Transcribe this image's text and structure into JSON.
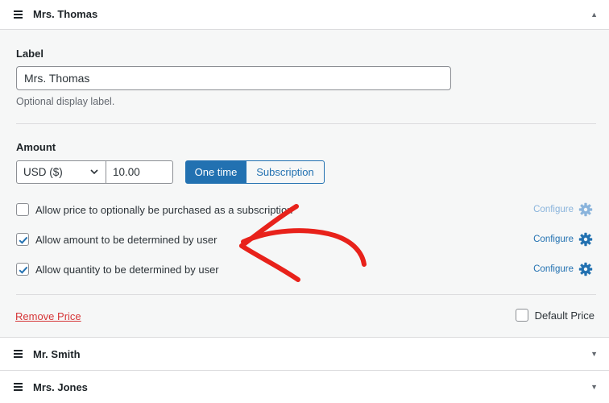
{
  "price_panel": {
    "title": "Mrs. Thomas",
    "label_field": {
      "label": "Label",
      "value": "Mrs. Thomas",
      "help": "Optional display label."
    },
    "amount": {
      "label": "Amount",
      "currency": "USD ($)",
      "value": "10.00",
      "mode_one_time": "One time",
      "mode_subscription": "Subscription"
    },
    "options": [
      {
        "label": "Allow price to optionally be purchased as a subscription",
        "checked": false,
        "configure": "Configure",
        "configure_enabled": false
      },
      {
        "label": "Allow amount to be determined by user",
        "checked": true,
        "configure": "Configure",
        "configure_enabled": true
      },
      {
        "label": "Allow quantity to be determined by user",
        "checked": true,
        "configure": "Configure",
        "configure_enabled": true
      }
    ],
    "remove_label": "Remove Price",
    "default_price_label": "Default Price"
  },
  "collapsed_panels": [
    {
      "title": "Mr. Smith"
    },
    {
      "title": "Mrs. Jones"
    }
  ],
  "colors": {
    "accent": "#2271b1",
    "danger": "#d63638",
    "annotation": "#e8221b"
  },
  "icons": {
    "drag": "drag-handle-icon",
    "expanded": "triangle-up-icon",
    "collapsed": "triangle-down-icon",
    "configure": "gear-icon",
    "select": "chevron-down-icon",
    "annotation": "hand-drawn-arrow-icon"
  }
}
